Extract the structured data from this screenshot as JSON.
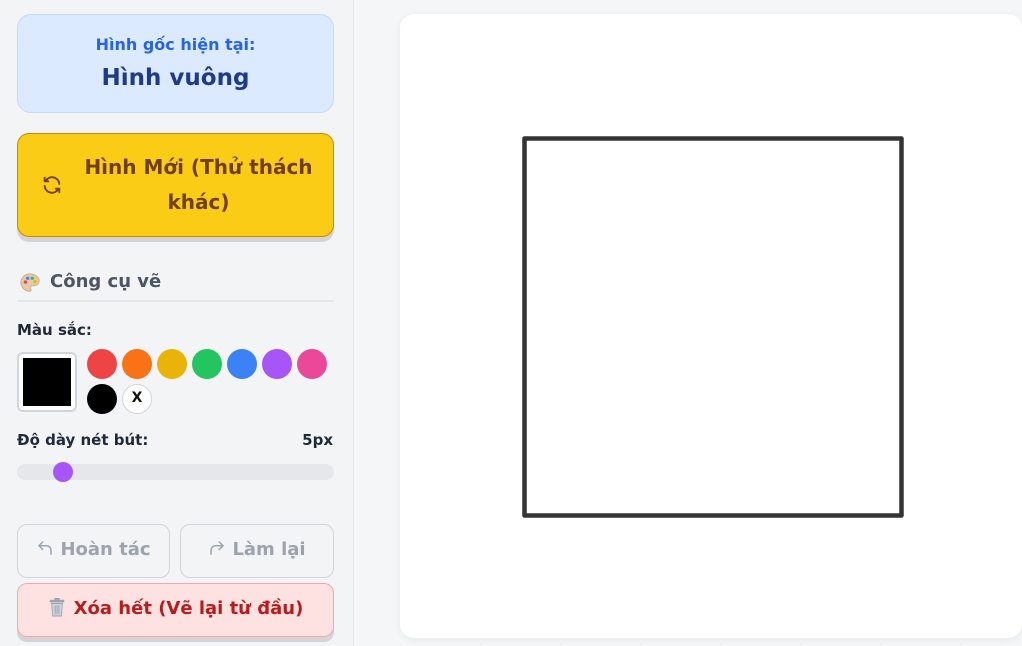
{
  "current_shape": {
    "label": "Hình gốc hiện tại:",
    "name": "Hình vuông"
  },
  "new_shape_button": {
    "label": "Hình Mới (Thử thách khác)",
    "icon": "refresh-icon"
  },
  "tools": {
    "title": "Công cụ vẽ",
    "icon": "palette-icon"
  },
  "colors": {
    "label": "Màu sắc:",
    "current": "#000000",
    "swatches": [
      "#ef4444",
      "#f97316",
      "#eab308",
      "#22c55e",
      "#3b82f6",
      "#a855f7",
      "#ec4899",
      "#000000"
    ],
    "eraser_label": "X"
  },
  "thickness": {
    "label": "Độ dày nét bút:",
    "value_text": "5px",
    "value": 5,
    "min": 1,
    "max": 50,
    "color": "#a855f7"
  },
  "actions": {
    "undo_label": "Hoàn tác",
    "redo_label": "Làm lại",
    "clear_label": "Xóa hết (Vẽ lại từ đầu)"
  },
  "canvas": {
    "shape": "square",
    "stroke_color": "#333333"
  }
}
